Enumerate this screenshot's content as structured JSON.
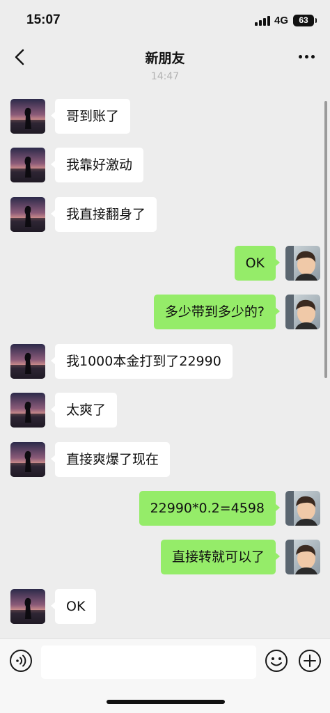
{
  "status_bar": {
    "time": "15:07",
    "network": "4G",
    "battery": "63"
  },
  "nav": {
    "back_icon": "chevron-left",
    "title": "新朋友",
    "more_icon": "ellipsis"
  },
  "timestamp": "14:47",
  "colors": {
    "background": "#ededed",
    "incoming_bubble": "#ffffff",
    "outgoing_bubble": "#95ec69",
    "input_bar": "#f7f7f7"
  },
  "messages": [
    {
      "side": "left",
      "text": "哥到账了"
    },
    {
      "side": "left",
      "text": "我靠好激动"
    },
    {
      "side": "left",
      "text": "我直接翻身了"
    },
    {
      "side": "right",
      "text": "OK"
    },
    {
      "side": "right",
      "text": "多少带到多少的?"
    },
    {
      "side": "left",
      "text": "我1000本金打到了22990"
    },
    {
      "side": "left",
      "text": "太爽了"
    },
    {
      "side": "left",
      "text": "直接爽爆了现在"
    },
    {
      "side": "right",
      "text": "22990*0.2=4598"
    },
    {
      "side": "right",
      "text": "直接转就可以了"
    },
    {
      "side": "left",
      "text": "OK"
    }
  ],
  "input_bar": {
    "voice_icon": "voice-wave",
    "message_value": "",
    "emoji_icon": "smiley",
    "plus_icon": "plus-circle"
  }
}
